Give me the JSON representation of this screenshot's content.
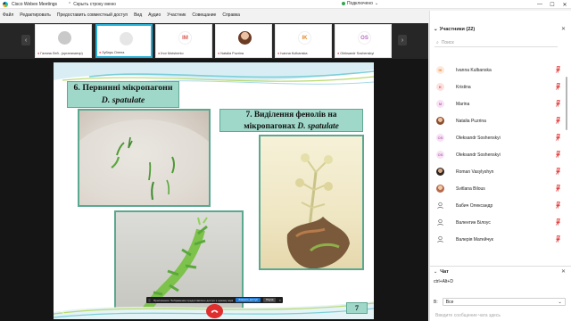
{
  "titlebar": {
    "app_title": "Cisco Webex Meetings",
    "hide_menu": "Скрыть строку меню",
    "connected": "Подключено"
  },
  "menu": [
    "Файл",
    "Редактировать",
    "Предоставить совместный доступ",
    "Вид",
    "Аудио",
    "Участник",
    "Совещание",
    "Справка"
  ],
  "strip": {
    "tiles": [
      {
        "name": "Галина Лей...(организатор)",
        "initials": "",
        "av_bg": "#c9c9c9",
        "av_fg": "#ffffff"
      },
      {
        "name": "Зубарь Олена",
        "initials": "",
        "av_bg": "#e6e6e6",
        "av_fg": "#ffffff"
      },
      {
        "name": "Ihor Motsherko",
        "initials": "IM",
        "av_bg": "#ffffff",
        "av_fg": "#d8534b"
      },
      {
        "name": "Natalia Puzrina",
        "initials": "",
        "av_bg": "#a56a4a",
        "av_fg": "#ffffff"
      },
      {
        "name": "Ivanna Kulbanska",
        "initials": "IK",
        "av_bg": "#ffffff",
        "av_fg": "#e08a2e"
      },
      {
        "name": "Oleksandr Soshenskyi",
        "initials": "OS",
        "av_bg": "#ffffff",
        "av_fg": "#b86cc2"
      }
    ]
  },
  "slide": {
    "heading1_line1": "6. Первинні мікропагони",
    "heading1_line2": "D. spatulate",
    "heading2_line1": "7. Виділення фенолів на",
    "heading2_line2_plain": "мікропагонах ",
    "heading2_line2_italic": "D. spatulate",
    "page_number": "7"
  },
  "share_bar": {
    "message": "Приложение \"Зображение предоставлено доступ к чужому экрану",
    "stop_label": "Закрыть доступ",
    "pause_label": "Пауза"
  },
  "panel": {
    "title": "Участники (22)",
    "search_placeholder": "Поиск",
    "participants": [
      {
        "name": "Ivanna Kulbanska",
        "initials": "IK",
        "av_bg": "#fde9dd",
        "av_fg": "#e08a2e"
      },
      {
        "name": "Kristina",
        "initials": "K",
        "av_bg": "#fde0e0",
        "av_fg": "#d8534b"
      },
      {
        "name": "Marina",
        "initials": "M",
        "av_bg": "#f7e1f2",
        "av_fg": "#b86cc2"
      },
      {
        "name": "Natalia Puzrina",
        "initials": "",
        "av_bg": "#a56a4a",
        "av_fg": "#ffffff"
      },
      {
        "name": "Oleksandr Soshenskyi",
        "initials": "OS",
        "av_bg": "#f7e1f2",
        "av_fg": "#b86cc2"
      },
      {
        "name": "Oleksandr Soshenskyi",
        "initials": "OS",
        "av_bg": "#f7e1f2",
        "av_fg": "#b86cc2"
      },
      {
        "name": "Roman Vasylyshyn",
        "initials": "",
        "av_bg": "#4a3a32",
        "av_fg": "#ffffff"
      },
      {
        "name": "Svitlana Bilous",
        "initials": "",
        "av_bg": "#c4886a",
        "av_fg": "#ffffff"
      },
      {
        "name": "Бабич Олександр",
        "initials": "",
        "av_bg": "#ffffff",
        "av_fg": "#555555"
      },
      {
        "name": "Валентин Білоус",
        "initials": "",
        "av_bg": "#ffffff",
        "av_fg": "#555555"
      },
      {
        "name": "Валерія Матейчук",
        "initials": "",
        "av_bg": "#ffffff",
        "av_fg": "#555555"
      }
    ],
    "chat_title": "Чат",
    "chat_message": "ctrl+Alt+D",
    "chat_to_label": "В:",
    "chat_to_value": "Все",
    "chat_input_placeholder": "Введите сообщение чата здесь"
  },
  "colors": {
    "accent": "#28b0d9",
    "end_call": "#e02d2d",
    "slide_teal": "#9fd8c9",
    "mic_muted": "#e23b3b"
  }
}
